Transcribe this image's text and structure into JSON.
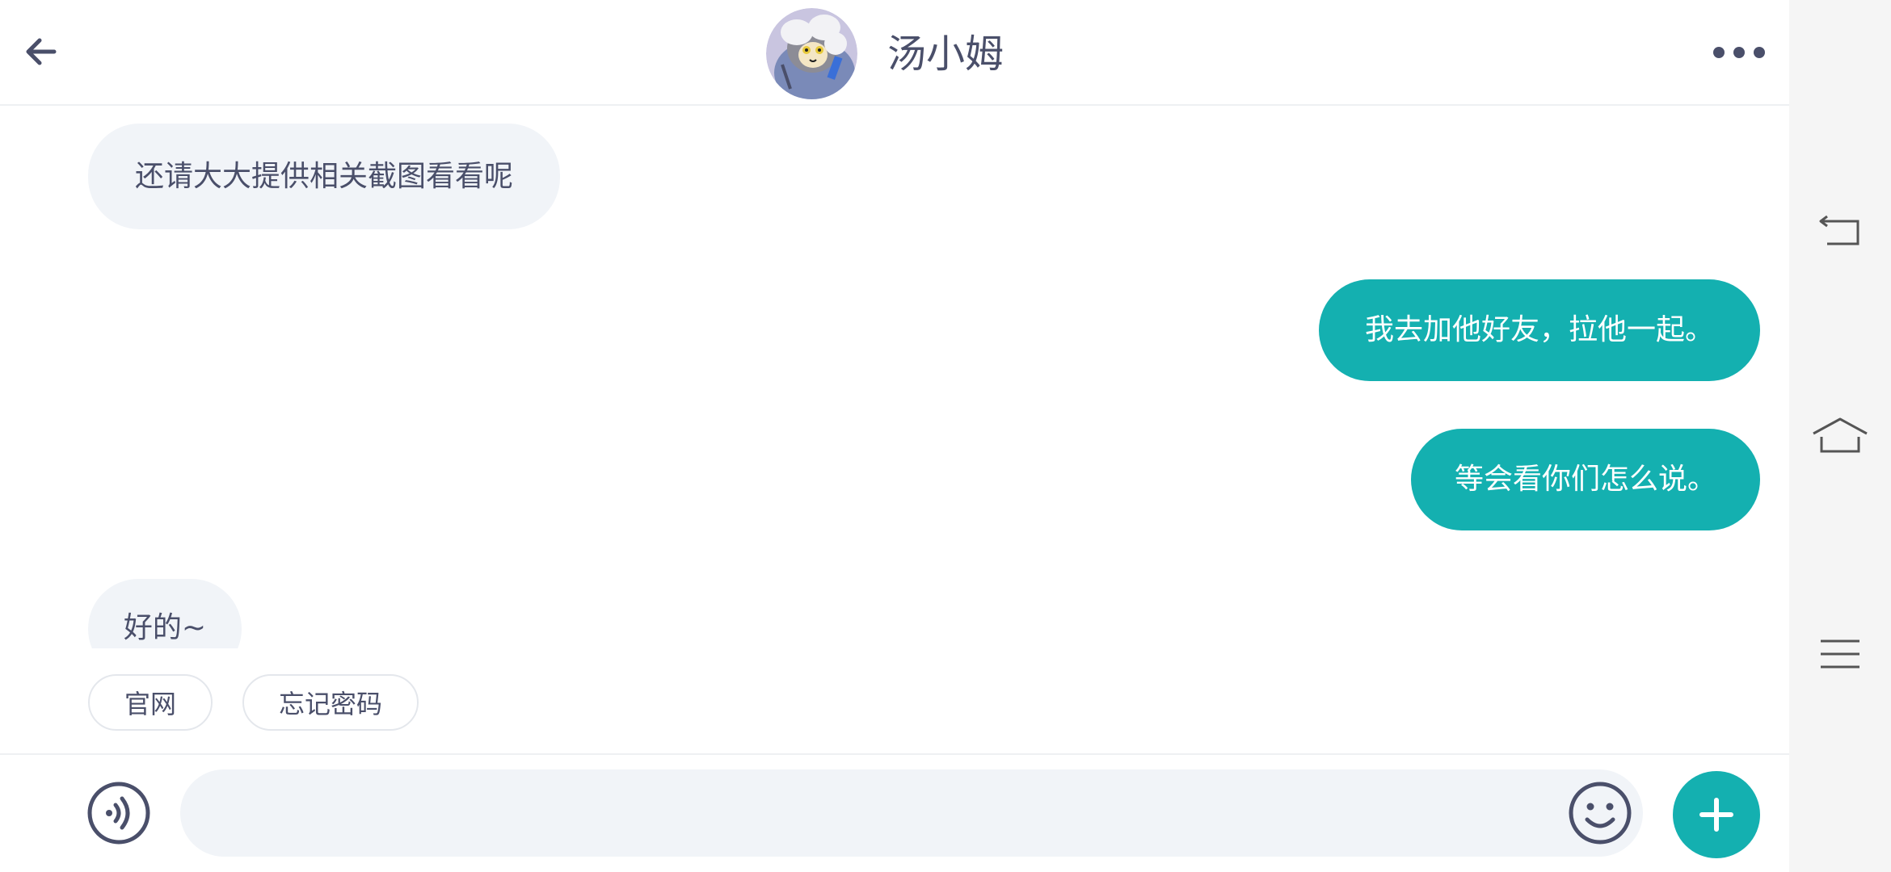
{
  "header": {
    "back_icon": "arrow-left-icon",
    "avatar_icon": "cartoon-cat-avatar",
    "contact_name": "汤小姆",
    "more_icon": "more-dots-icon"
  },
  "messages": [
    {
      "direction": "incoming",
      "text": "还请大大提供相关截图看看呢"
    },
    {
      "direction": "outgoing",
      "text": "我去加他好友，拉他一起。"
    },
    {
      "direction": "outgoing",
      "text": "等会看你们怎么说。"
    },
    {
      "direction": "incoming",
      "text": "好的~"
    }
  ],
  "quick_replies": [
    {
      "label": "官网"
    },
    {
      "label": "忘记密码"
    }
  ],
  "input_bar": {
    "voice_icon": "voice-icon",
    "text_value": "",
    "emoji_icon": "emoji-icon",
    "plus_icon": "plus-icon"
  },
  "system_nav": {
    "back_icon": "system-back-icon",
    "home_icon": "home-icon",
    "recents_icon": "menu-lines-icon"
  },
  "colors": {
    "accent": "#14b0b0",
    "incoming_bubble": "#f1f4f8",
    "text_primary": "#4a4f6a",
    "nav_background": "#f5f5f5"
  }
}
